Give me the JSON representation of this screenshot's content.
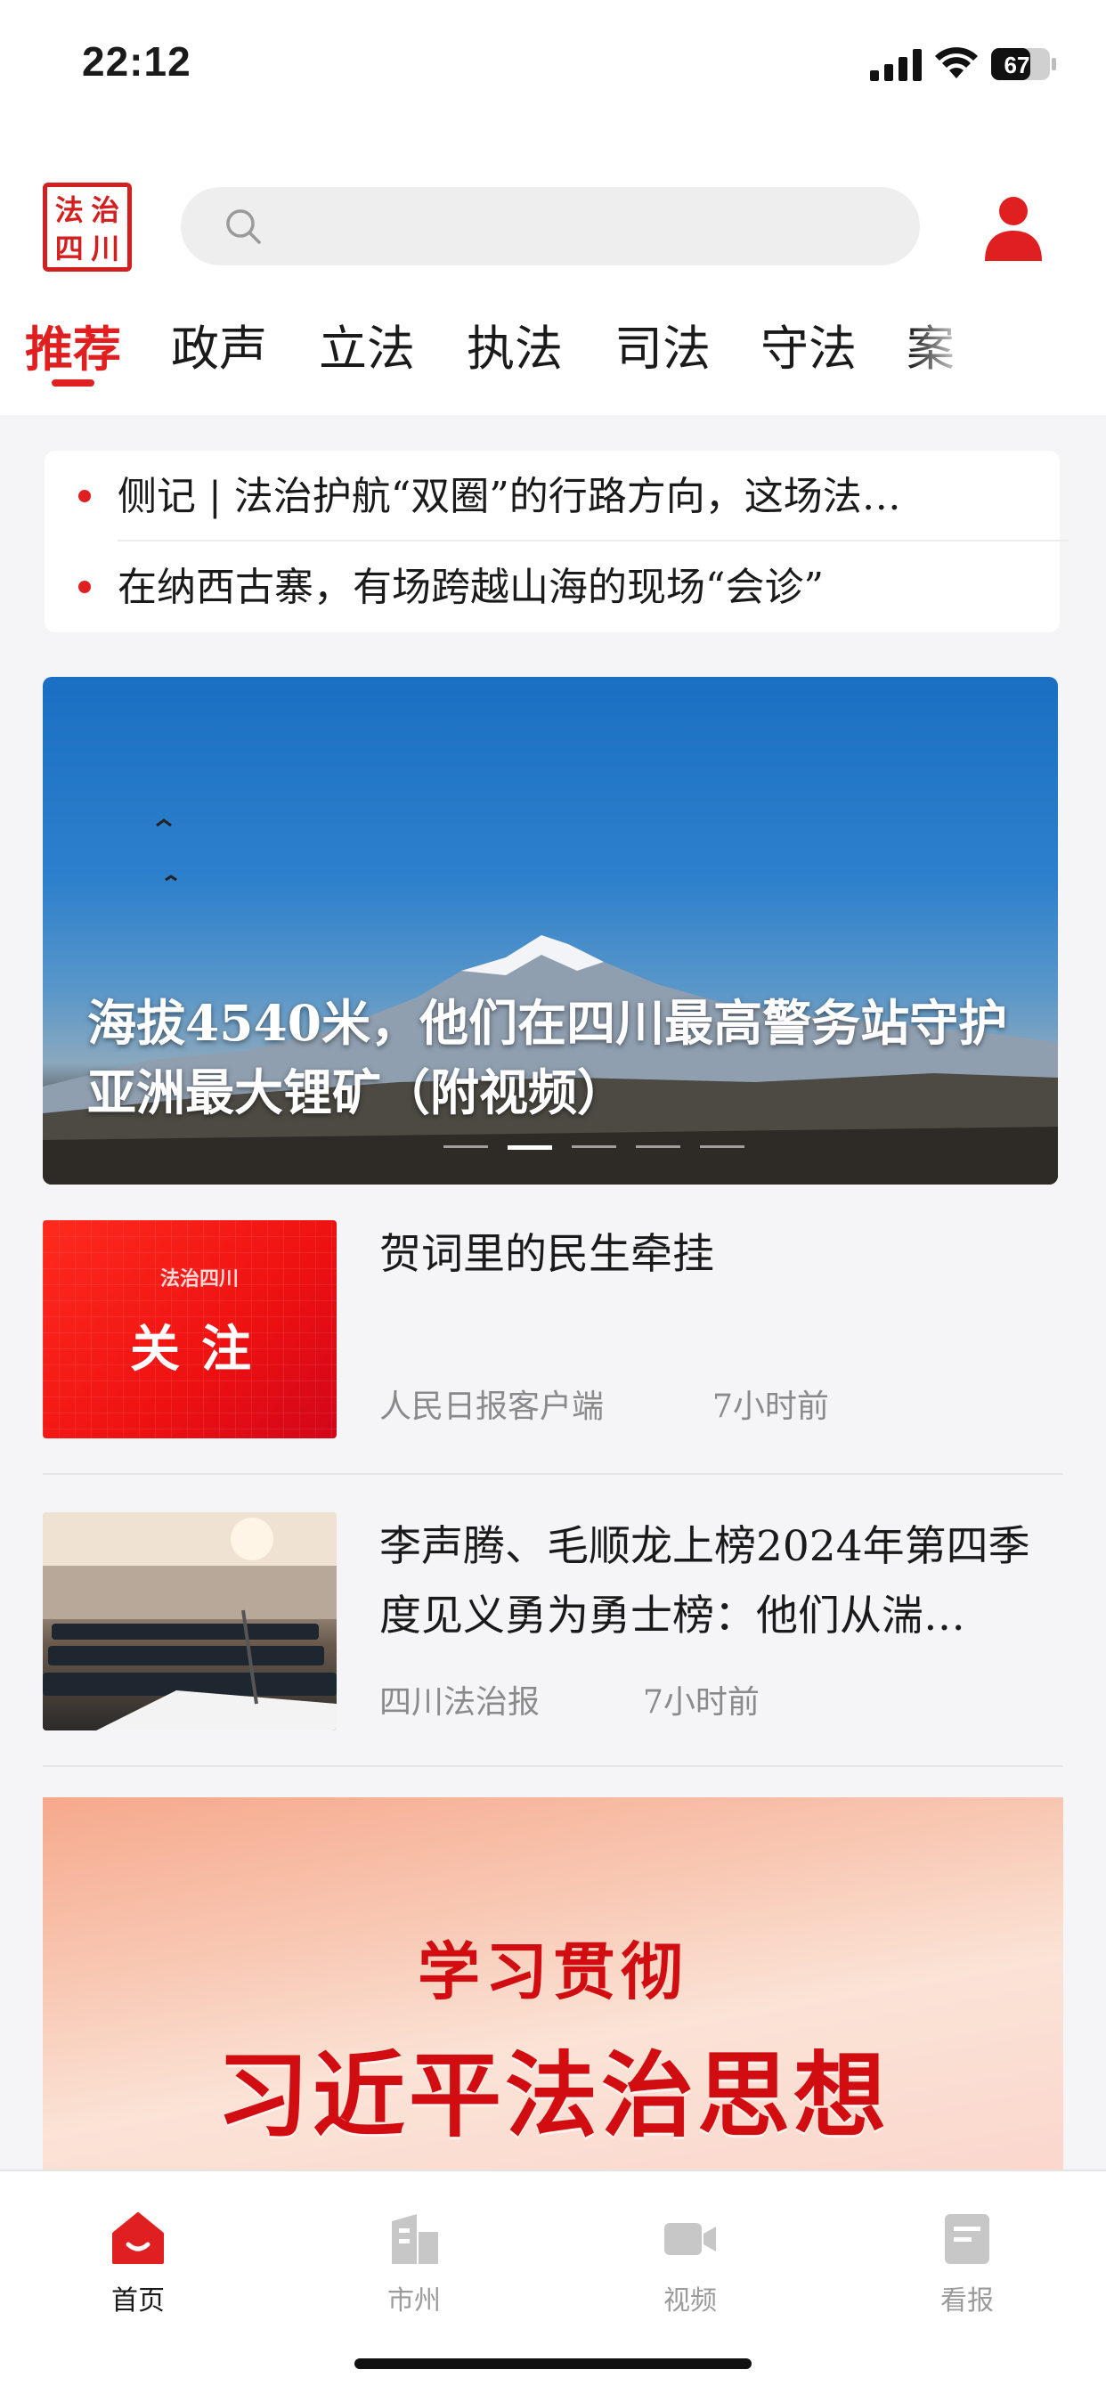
{
  "status_bar": {
    "time": "22:12",
    "battery": "67"
  },
  "header": {
    "logo_chars": [
      "法",
      "治",
      "四",
      "川"
    ],
    "search_placeholder": ""
  },
  "tabs": [
    "推荐",
    "政声",
    "立法",
    "执法",
    "司法",
    "守法",
    "案"
  ],
  "active_tab": "推荐",
  "headlines": [
    "侧记 | 法治护航“双圈”的行路方向，这场法…",
    "在纳西古寨，有场跨越山海的现场“会诊”"
  ],
  "banner": {
    "title": "海拔4540米，他们在四川最高警务站守护亚洲最大锂矿（附视频）",
    "slide_count": 5,
    "active_slide": 2
  },
  "news": [
    {
      "title": "贺词里的民生牵挂",
      "source": "人民日报客户端",
      "time": "7小时前",
      "thumb_badge": "法治四川",
      "thumb_text": "关注"
    },
    {
      "title": "李声腾、毛顺龙上榜2024年第四季度见义勇为勇士榜：他们从湍…",
      "source": "四川法治报",
      "time": "7小时前"
    }
  ],
  "promo": {
    "line1": "学习贯彻",
    "line2": "习近平法治思想"
  },
  "bottom_nav": [
    {
      "label": "首页",
      "icon": "home-icon",
      "active": true
    },
    {
      "label": "市州",
      "icon": "city-icon",
      "active": false
    },
    {
      "label": "视频",
      "icon": "video-icon",
      "active": false
    },
    {
      "label": "看报",
      "icon": "newspaper-icon",
      "active": false
    }
  ],
  "colors": {
    "accent": "#e02020",
    "inactive": "#9b9b9b",
    "background": "#f5f5f7"
  }
}
